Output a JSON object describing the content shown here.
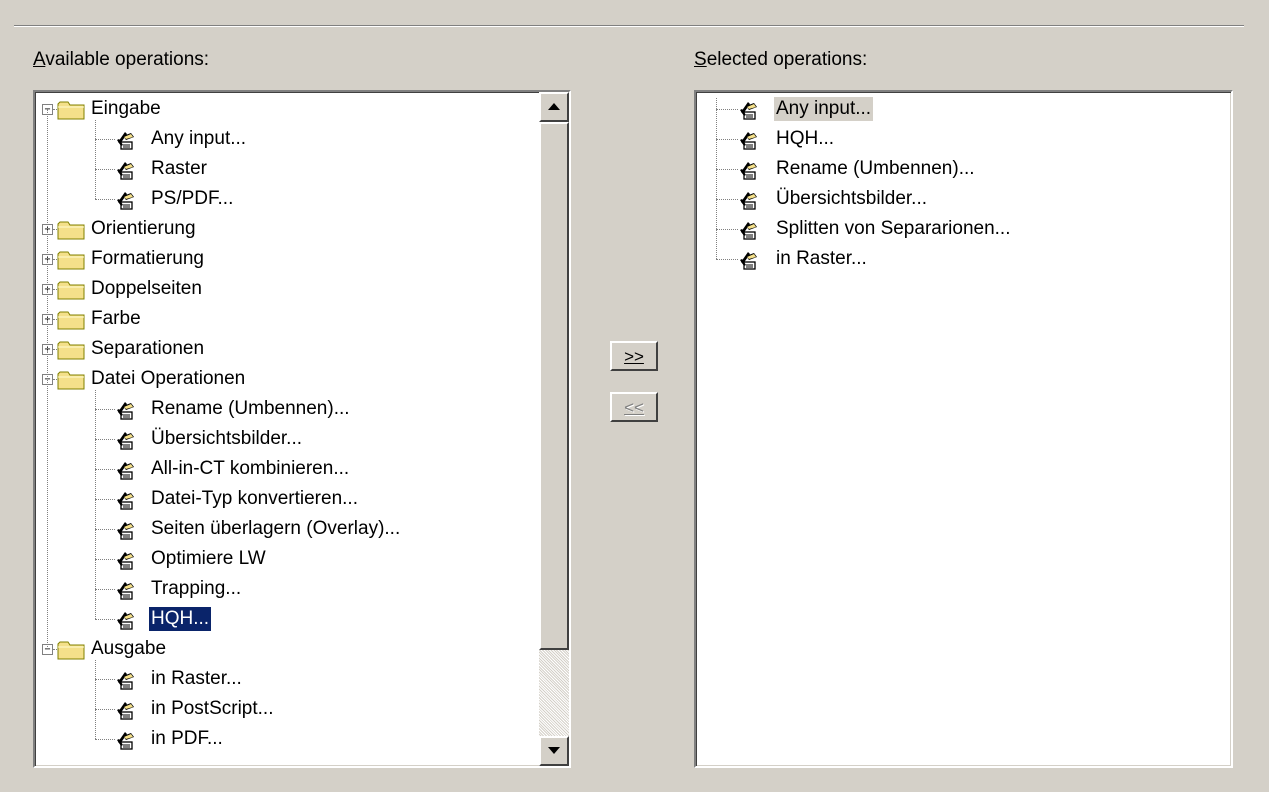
{
  "labels": {
    "available_mnemonic": "A",
    "available_rest": "vailable operations:",
    "selected_mnemonic": "S",
    "selected_rest": "elected operations:"
  },
  "buttons": {
    "add_label": ">>",
    "remove_label": "<<"
  },
  "available_tree": [
    {
      "type": "folder",
      "label": "Eingabe",
      "expanded": true,
      "level": 0
    },
    {
      "type": "op",
      "label": "Any input...",
      "level": 1
    },
    {
      "type": "op",
      "label": "Raster",
      "level": 1
    },
    {
      "type": "op",
      "label": "PS/PDF...",
      "level": 1
    },
    {
      "type": "folder",
      "label": "Orientierung",
      "expanded": false,
      "level": 0
    },
    {
      "type": "folder",
      "label": "Formatierung",
      "expanded": false,
      "level": 0
    },
    {
      "type": "folder",
      "label": "Doppelseiten",
      "expanded": false,
      "level": 0
    },
    {
      "type": "folder",
      "label": "Farbe",
      "expanded": false,
      "level": 0
    },
    {
      "type": "folder",
      "label": "Separationen",
      "expanded": false,
      "level": 0
    },
    {
      "type": "folder",
      "label": "Datei Operationen",
      "expanded": true,
      "level": 0
    },
    {
      "type": "op",
      "label": "Rename (Umbennen)...",
      "level": 1
    },
    {
      "type": "op",
      "label": "Übersichtsbilder...",
      "level": 1
    },
    {
      "type": "op",
      "label": "All-in-CT kombinieren...",
      "level": 1
    },
    {
      "type": "op",
      "label": "Datei-Typ konvertieren...",
      "level": 1
    },
    {
      "type": "op",
      "label": "Seiten überlagern (Overlay)...",
      "level": 1
    },
    {
      "type": "op",
      "label": "Optimiere LW",
      "level": 1
    },
    {
      "type": "op",
      "label": "Trapping...",
      "level": 1
    },
    {
      "type": "op",
      "label": "HQH...",
      "level": 1,
      "selected": true
    },
    {
      "type": "folder",
      "label": "Ausgabe",
      "expanded": true,
      "level": 0
    },
    {
      "type": "op",
      "label": "in Raster...",
      "level": 1
    },
    {
      "type": "op",
      "label": "in PostScript...",
      "level": 1
    },
    {
      "type": "op",
      "label": "in PDF...",
      "level": 1
    }
  ],
  "selected_list": [
    {
      "label": "Any input...",
      "highlighted": true
    },
    {
      "label": "HQH..."
    },
    {
      "label": "Rename (Umbennen)..."
    },
    {
      "label": "Übersichtsbilder..."
    },
    {
      "label": "Splitten von Separarionen..."
    },
    {
      "label": "in Raster..."
    }
  ],
  "icons": {
    "folder": "folder-icon",
    "operation": "operation-icon",
    "expand": "plus-box-icon",
    "collapse": "minus-box-icon"
  },
  "colors": {
    "dialog_bg": "#d4d0c8",
    "selection_bg": "#0a246a",
    "folder_yellow": "#f4e08a"
  }
}
